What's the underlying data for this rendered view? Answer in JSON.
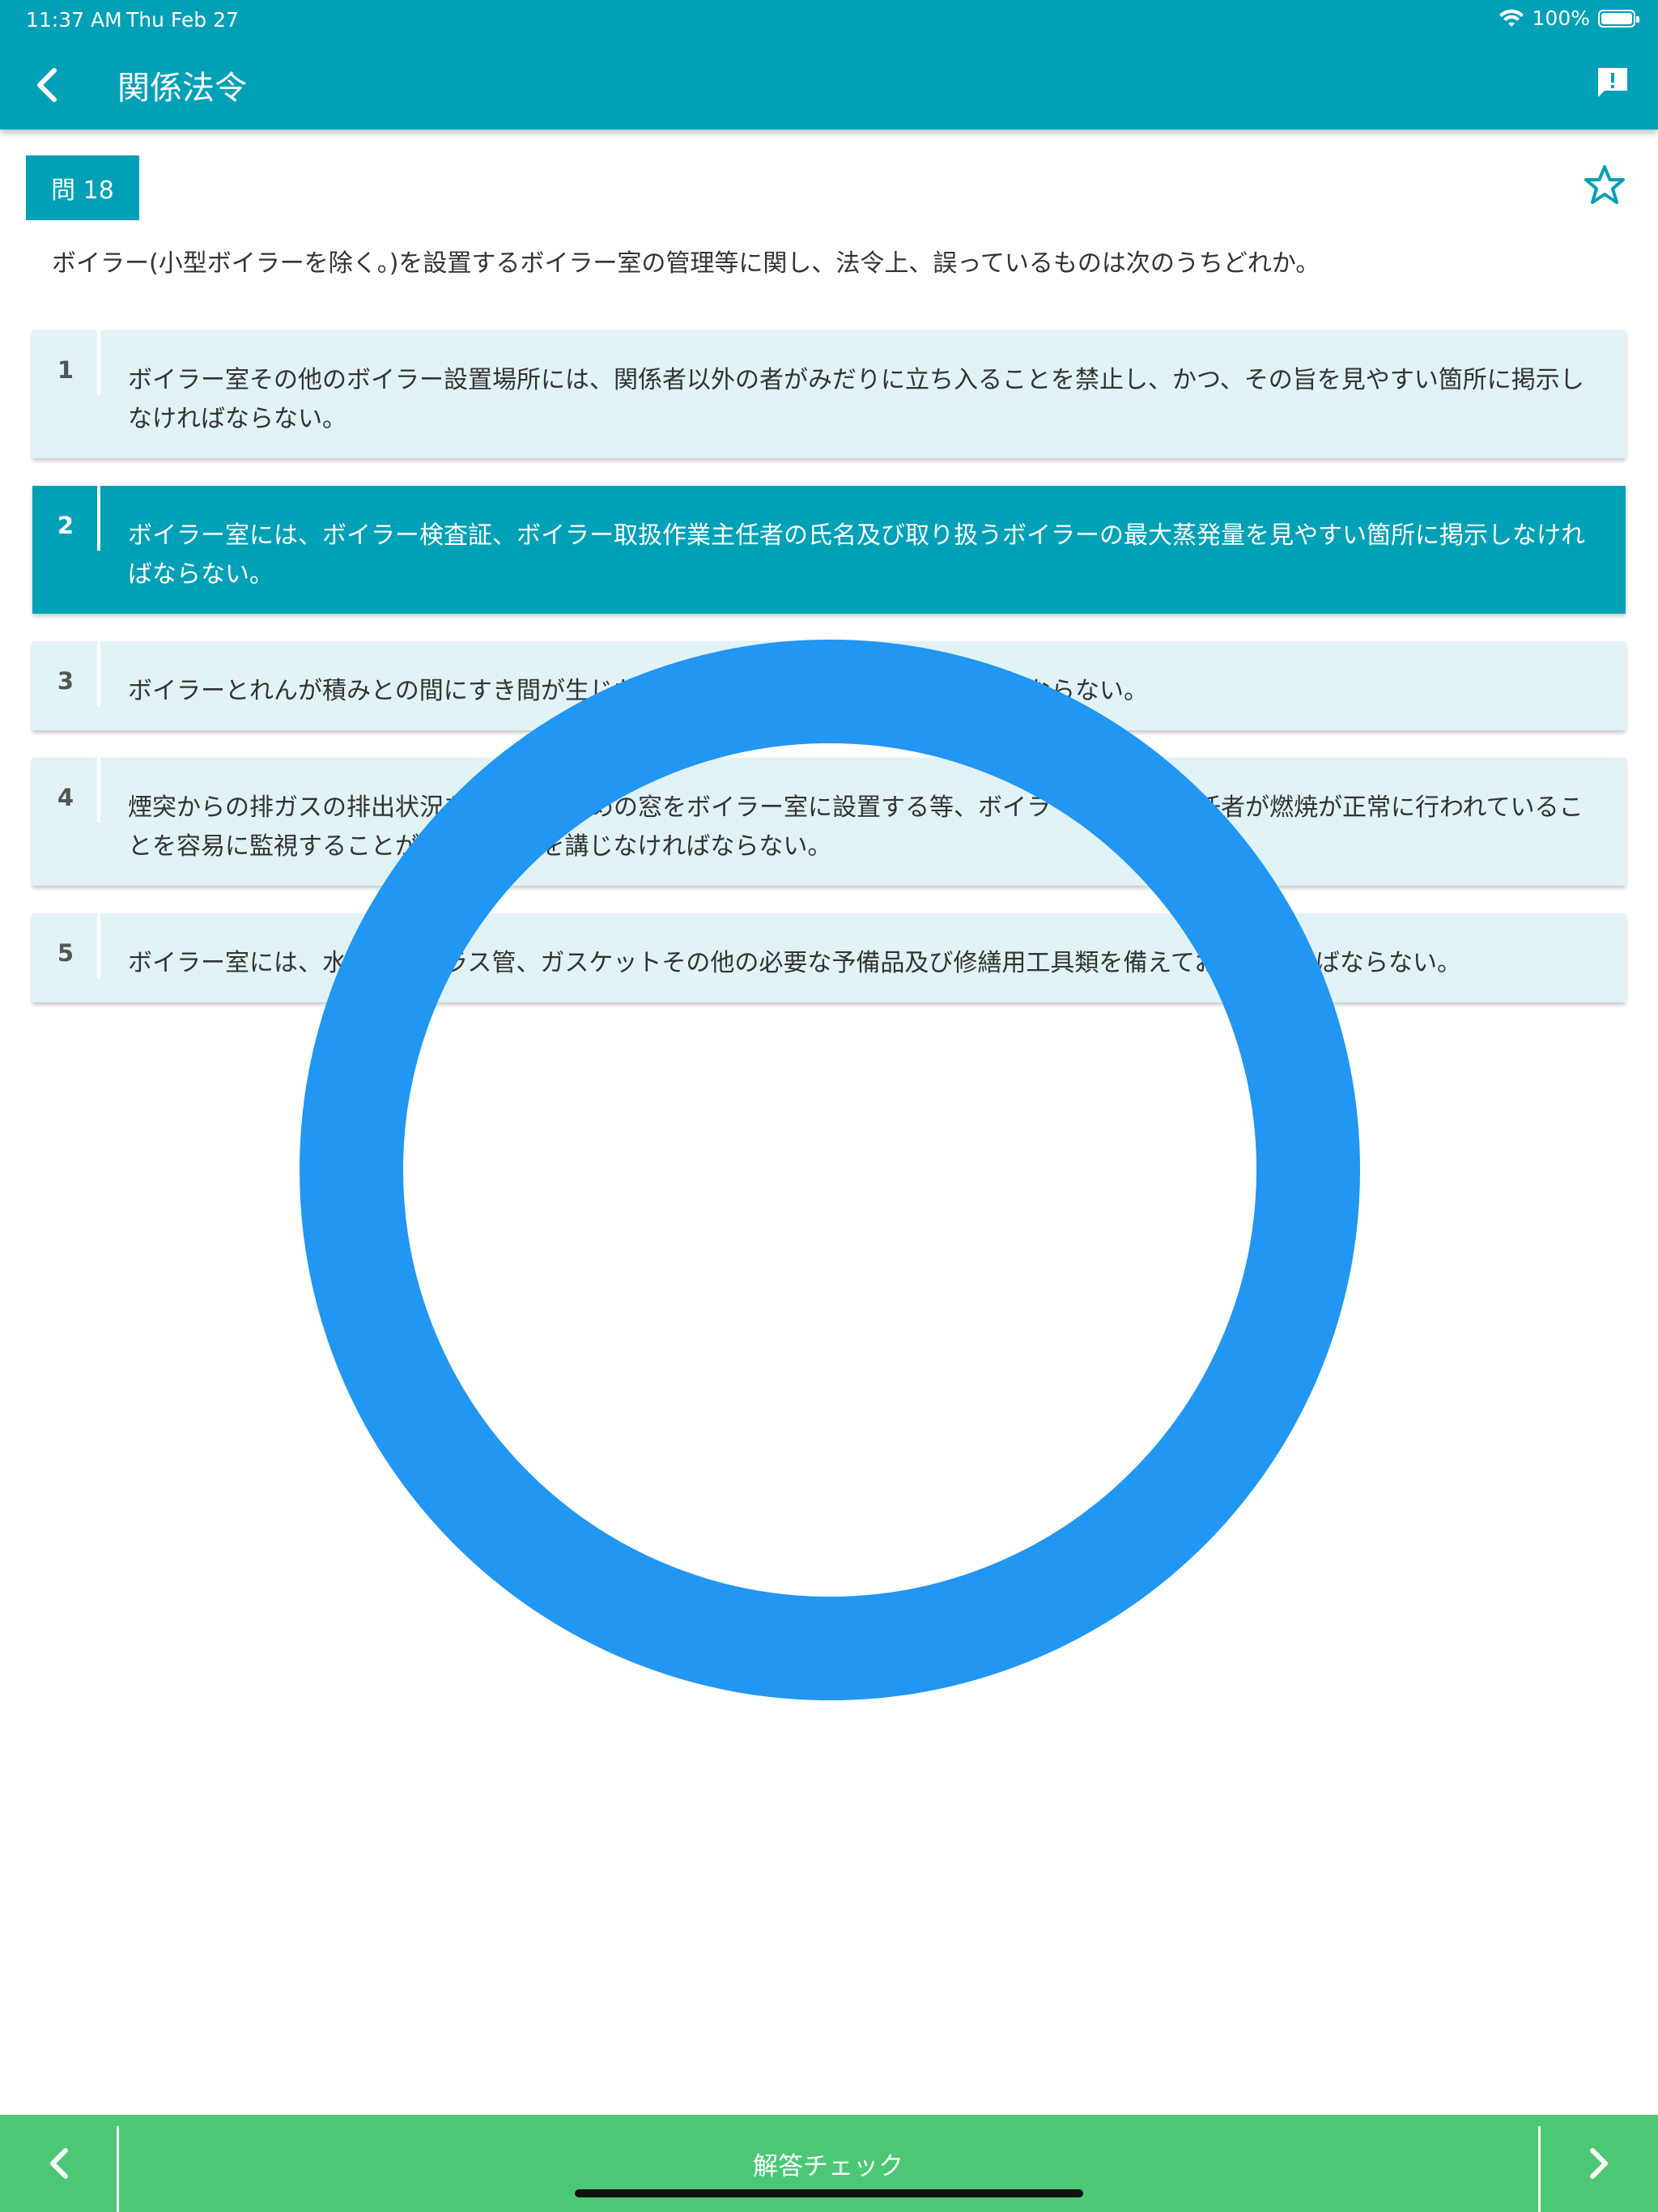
{
  "status_bar": {
    "time": "11:37 AM",
    "date": "Thu Feb 27",
    "battery": "100%"
  },
  "nav": {
    "title": "関係法令"
  },
  "question": {
    "number_label": "問 18",
    "text": "ボイラー(小型ボイラーを除く。)を設置するボイラー室の管理等に関し、法令上、誤っているものは次のうちどれか。"
  },
  "choices": [
    {
      "number": "1",
      "text": "ボイラー室その他のボイラー設置場所には、関係者以外の者がみだりに立ち入ることを禁止し、かつ、その旨を見やすい箇所に掲示しなければならない。"
    },
    {
      "number": "2",
      "text": "ボイラー室には、ボイラー検査証、ボイラー取扱作業主任者の氏名及び取り扱うボイラーの最大蒸発量を見やすい箇所に掲示しなければならない。"
    },
    {
      "number": "3",
      "text": "ボイラーとれんが積みとの間にすき間が生じたときは、すみやかに補修しなければならない。"
    },
    {
      "number": "4",
      "text": "煙突からの排ガスの排出状況を観測するための窓をボイラー室に設置する等、ボイラー取扱作業主任者が燃焼が正常に行われていることを容易に監視することができる措置を講じなければならない。"
    },
    {
      "number": "5",
      "text": "ボイラー室には、水面計のガラス管、ガスケットその他の必要な予備品及び修繕用工具類を備えておかなければならない。"
    }
  ],
  "selected_choice": "2",
  "result": {
    "mark": "correct-circle",
    "color": "#2196f3"
  },
  "bottom_bar": {
    "check_label": "解答チェック"
  },
  "colors": {
    "teal": "#00a0b7",
    "choice_bg": "#e1f3f6",
    "green": "#4cc875",
    "ring_blue": "#2196f3"
  },
  "icons": {
    "back": "chevron-left-icon",
    "report": "report-bubble-icon",
    "favorite": "star-outline-icon",
    "prev": "chevron-left-icon",
    "next": "chevron-right-icon",
    "wifi": "wifi-icon",
    "battery": "battery-icon"
  }
}
